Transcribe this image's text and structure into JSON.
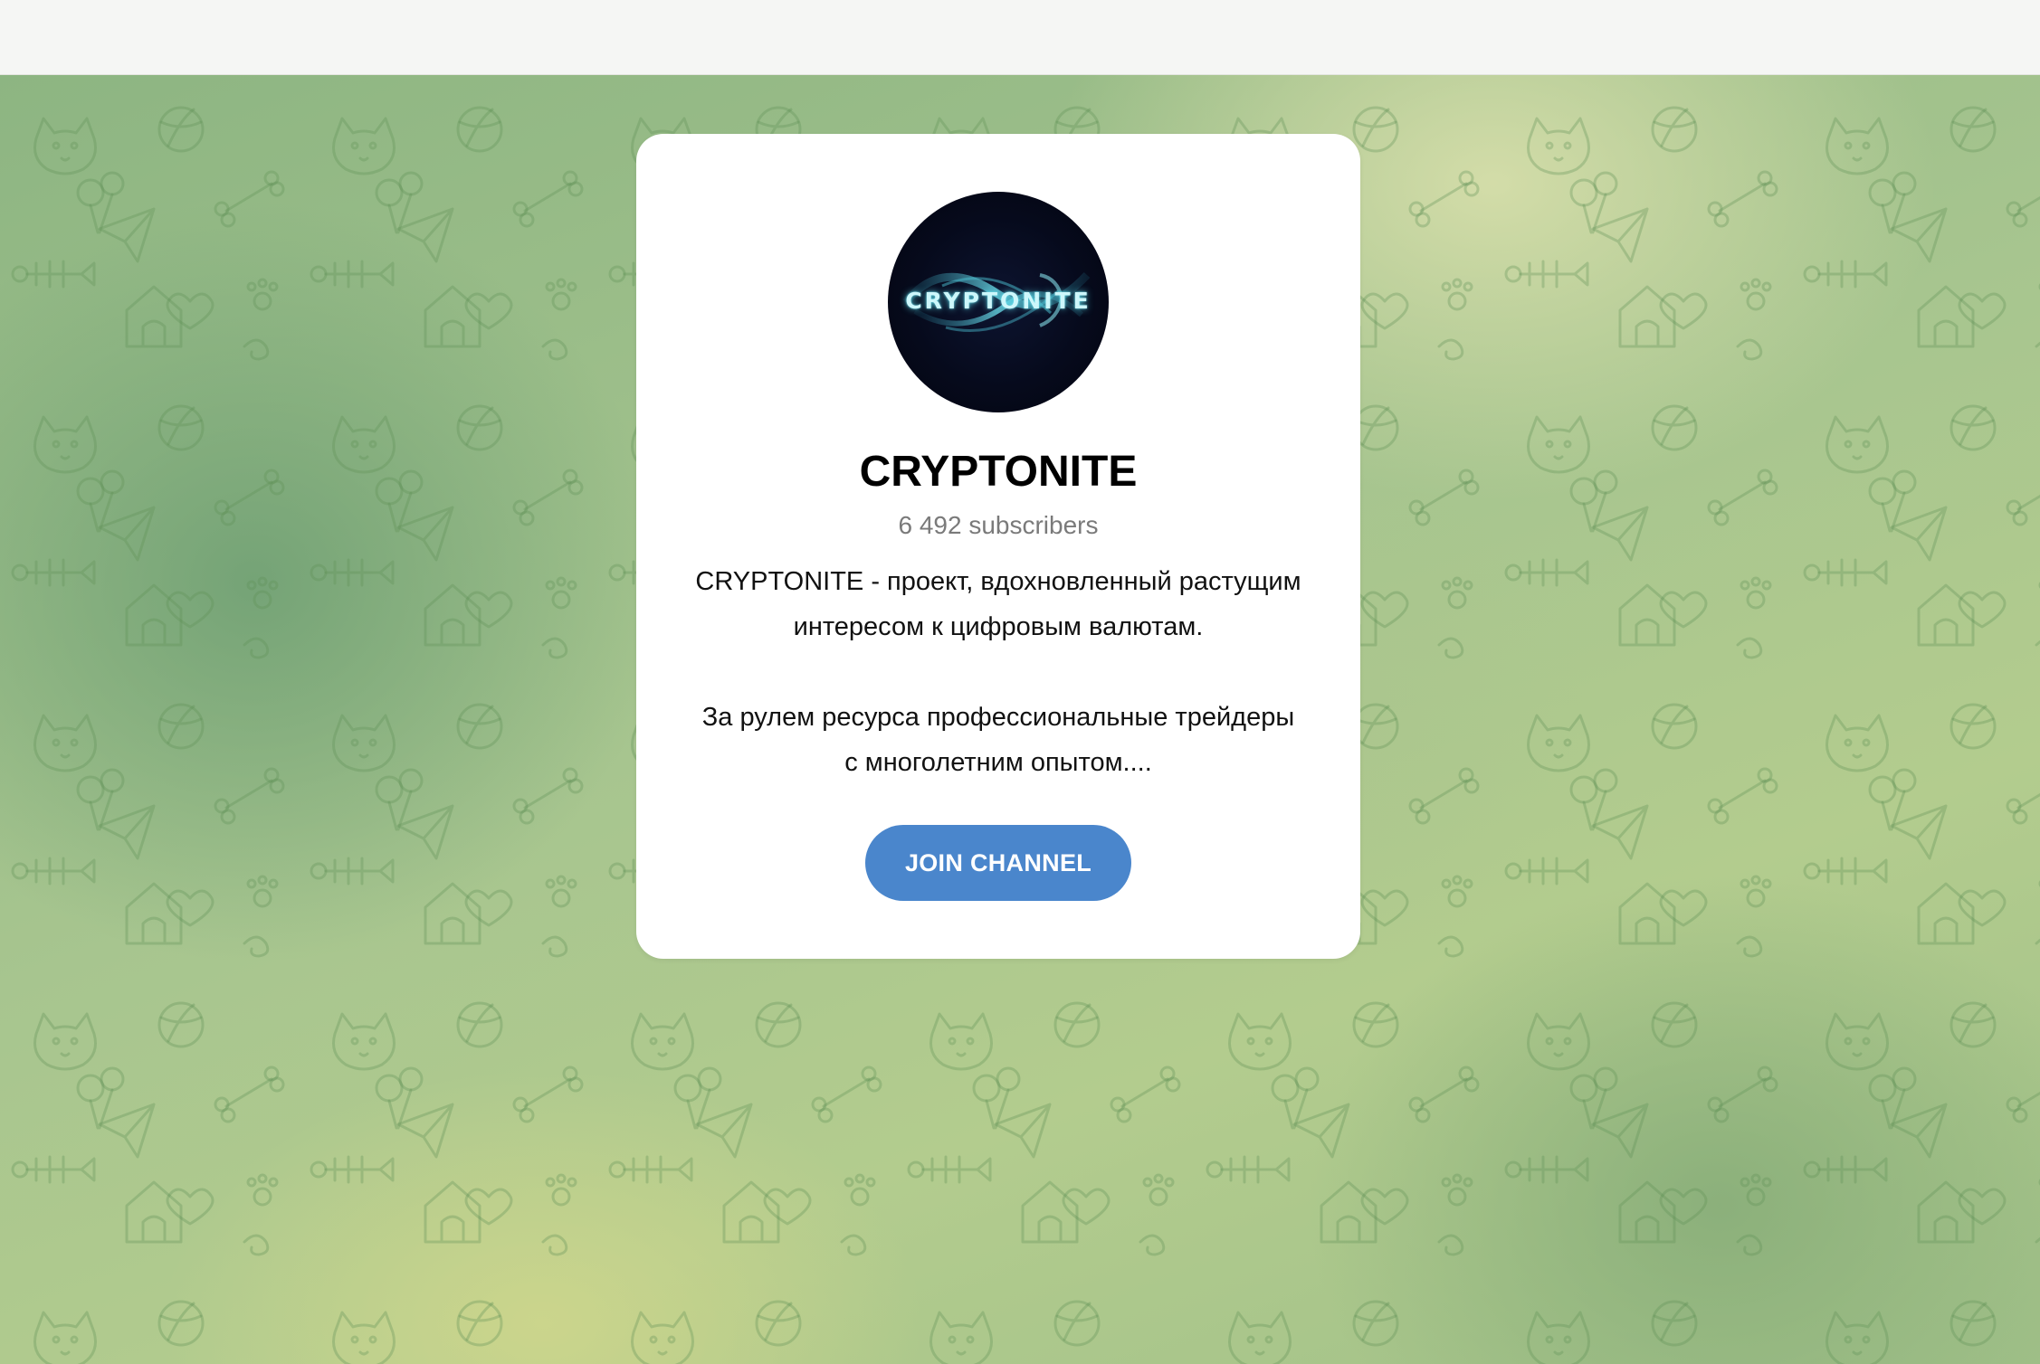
{
  "channel": {
    "name": "CRYPTONITE",
    "subscribers": "6 492 subscribers",
    "description_lines": [
      "CRYPTONITE - проект, вдохновленный растущим",
      "интересом к цифровым валютам.",
      "За рулем ресурса профессиональные трейдеры",
      "с многолетним опытом...."
    ],
    "avatar": {
      "logo_text": "CRYPTONITE",
      "icon": "cryptonite-logo-avatar"
    }
  },
  "actions": {
    "join_label": "JOIN CHANNEL"
  },
  "colors": {
    "button": "#4a86cc",
    "card": "#ffffff",
    "topbar": "#f5f6f4",
    "background": "#9fc08a"
  },
  "background": {
    "pattern": "telegram-doodle-pattern"
  }
}
